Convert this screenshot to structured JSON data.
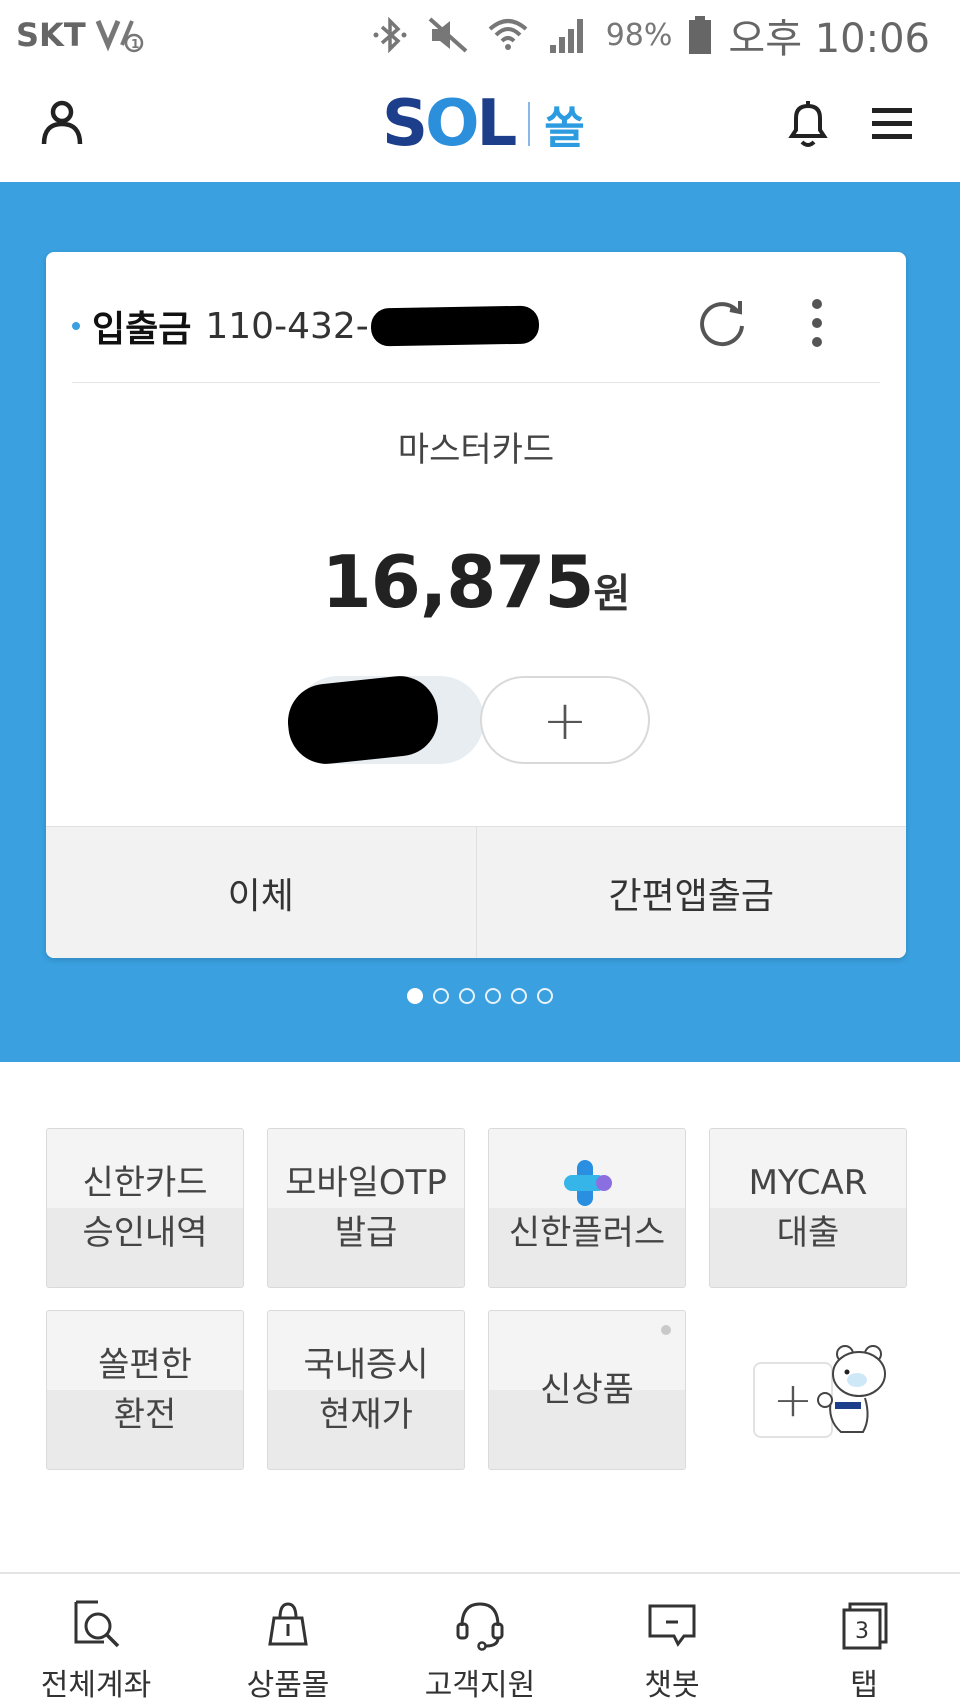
{
  "status_bar": {
    "carrier": "SKT",
    "battery": "98%",
    "time": "오후 10:06"
  },
  "header": {
    "logo_text": "SOL",
    "logo_ko": "쏠"
  },
  "account_card": {
    "account_type": "입출금",
    "account_number_prefix": "110-432-",
    "card_name": "마스터카드",
    "balance": "16,875",
    "currency": "원",
    "add_label": "+",
    "actions": [
      "이체",
      "간편앱출금"
    ],
    "page_count": 6,
    "current_page": 1
  },
  "shortcuts": [
    {
      "line1": "신한카드",
      "line2": "승인내역"
    },
    {
      "line1": "모바일OTP",
      "line2": "발급"
    },
    {
      "line1": "",
      "line2": "신한플러스"
    },
    {
      "line1": "MYCAR",
      "line2": "대출"
    },
    {
      "line1": "쏠편한",
      "line2": "환전"
    },
    {
      "line1": "국내증시",
      "line2": "현재가"
    },
    {
      "line1": "신상품",
      "line2": ""
    }
  ],
  "add_shortcut_label": "+",
  "bottom_nav": [
    {
      "label": "전체계좌",
      "icon": "all-accounts-icon"
    },
    {
      "label": "상품몰",
      "icon": "shopping-bag-icon"
    },
    {
      "label": "고객지원",
      "icon": "headset-icon"
    },
    {
      "label": "챗봇",
      "icon": "chat-icon"
    },
    {
      "label": "탭",
      "icon": "tabs-icon",
      "badge": "3"
    }
  ],
  "colors": {
    "brand_blue": "#3aa0e0",
    "logo_navy": "#1d3e8a"
  }
}
